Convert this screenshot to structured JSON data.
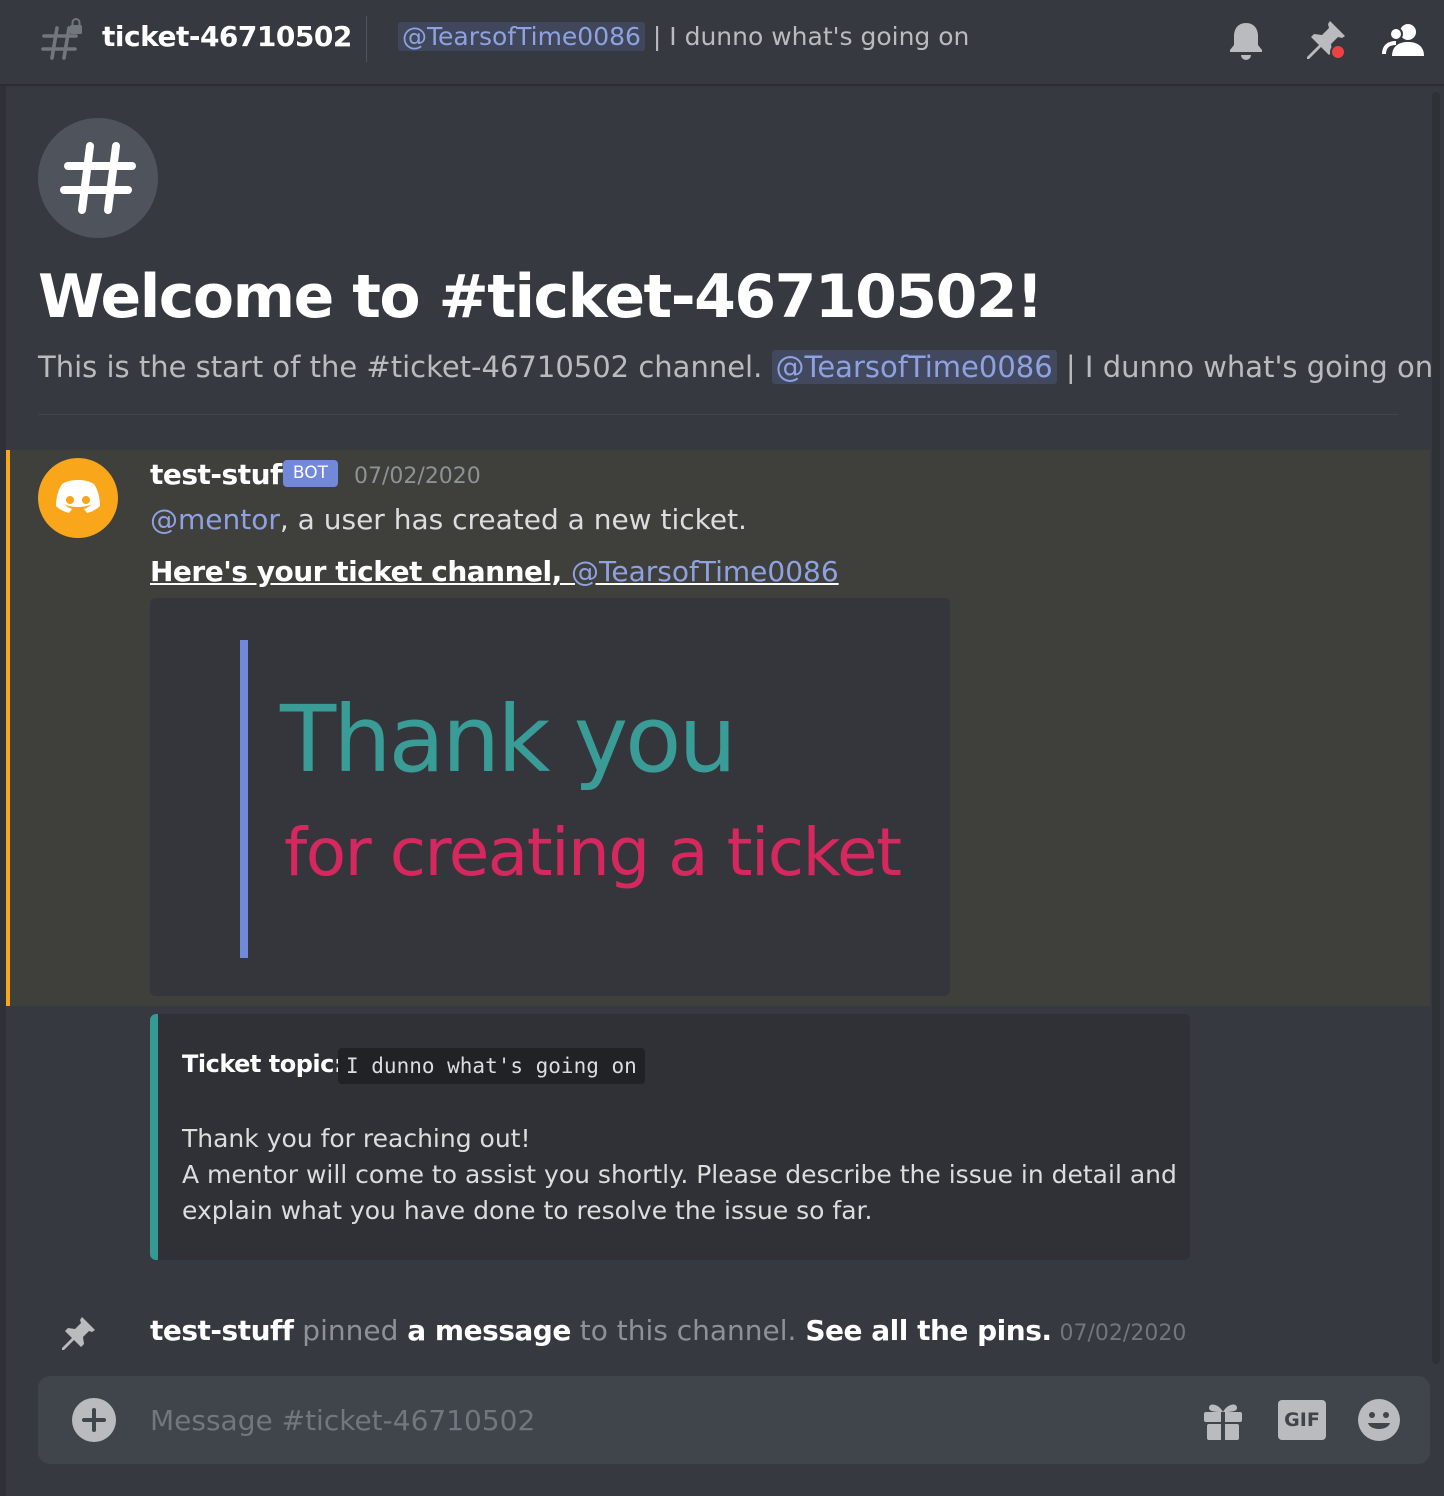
{
  "header": {
    "channel_name": "ticket-46710502",
    "topic_mention": "@TearsofTime0086",
    "topic_rest": " | I dunno what's going on",
    "icons": [
      "locked-channel-hash-icon",
      "bell-icon",
      "pin-icon",
      "members-icon"
    ]
  },
  "welcome": {
    "title": "Welcome to #ticket-46710502!",
    "subtitle_prefix": "This is the start of the #ticket-46710502 channel. ",
    "mention": "@TearsofTime0086",
    "subtitle_suffix": " | I dunno what's going on"
  },
  "message": {
    "author": "test-stuff",
    "bot_tag": "BOT",
    "timestamp": "07/02/2020",
    "role_mention": "@mentor",
    "line1_rest": ", a user has created a new ticket.",
    "line2_bold": "Here's your ticket channel, ",
    "line2_mention": "@TearsofTime0086",
    "image_text_1": "Thank you",
    "image_text_2": "for creating a ticket"
  },
  "embed": {
    "topic_label": "Ticket topic:",
    "topic_value": "I dunno what's going on",
    "line1": "Thank you for reaching out!",
    "line2": "A mentor will come to assist you shortly. Please describe the issue in detail and",
    "line3": "explain what you have done to resolve the issue so far."
  },
  "pin_message": {
    "author": "test-stuff",
    "verb": " pinned ",
    "object": "a message",
    "middle": " to this channel. ",
    "link": "See all the pins.",
    "timestamp": "07/02/2020"
  },
  "composer": {
    "placeholder": "Message #ticket-46710502",
    "gif_label": "GIF"
  },
  "colors": {
    "accent": "#7289da",
    "highlight_border": "#faa61a",
    "embed_border": "#349a93",
    "image_text_teal": "#3a9c97",
    "image_text_pink": "#d6285f"
  }
}
